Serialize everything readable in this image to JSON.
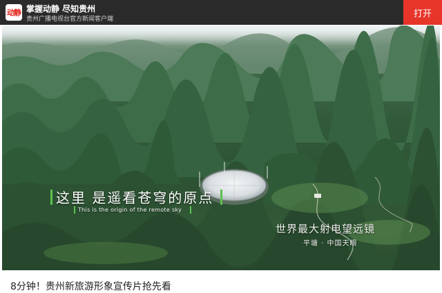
{
  "banner": {
    "logo_text": "动静",
    "title": "掌握动静 尽知贵州",
    "subtitle": "贵州广播电视台官方新闻客户端",
    "open_button": "打开"
  },
  "video": {
    "subtitle_cn": "这里 是遥看苍穹的原点",
    "subtitle_en": "This is the origin of the remote sky",
    "caption_main": "世界最大射电望远镜",
    "caption_sub": "平塘 · 中国天眼"
  },
  "article": {
    "title": "8分钟！贵州新旅游形象宣传片抢先看"
  },
  "colors": {
    "banner_bg": "#2b2b2b",
    "open_button_bg": "#e8352a",
    "subtitle_accent": "#5cc24e"
  }
}
